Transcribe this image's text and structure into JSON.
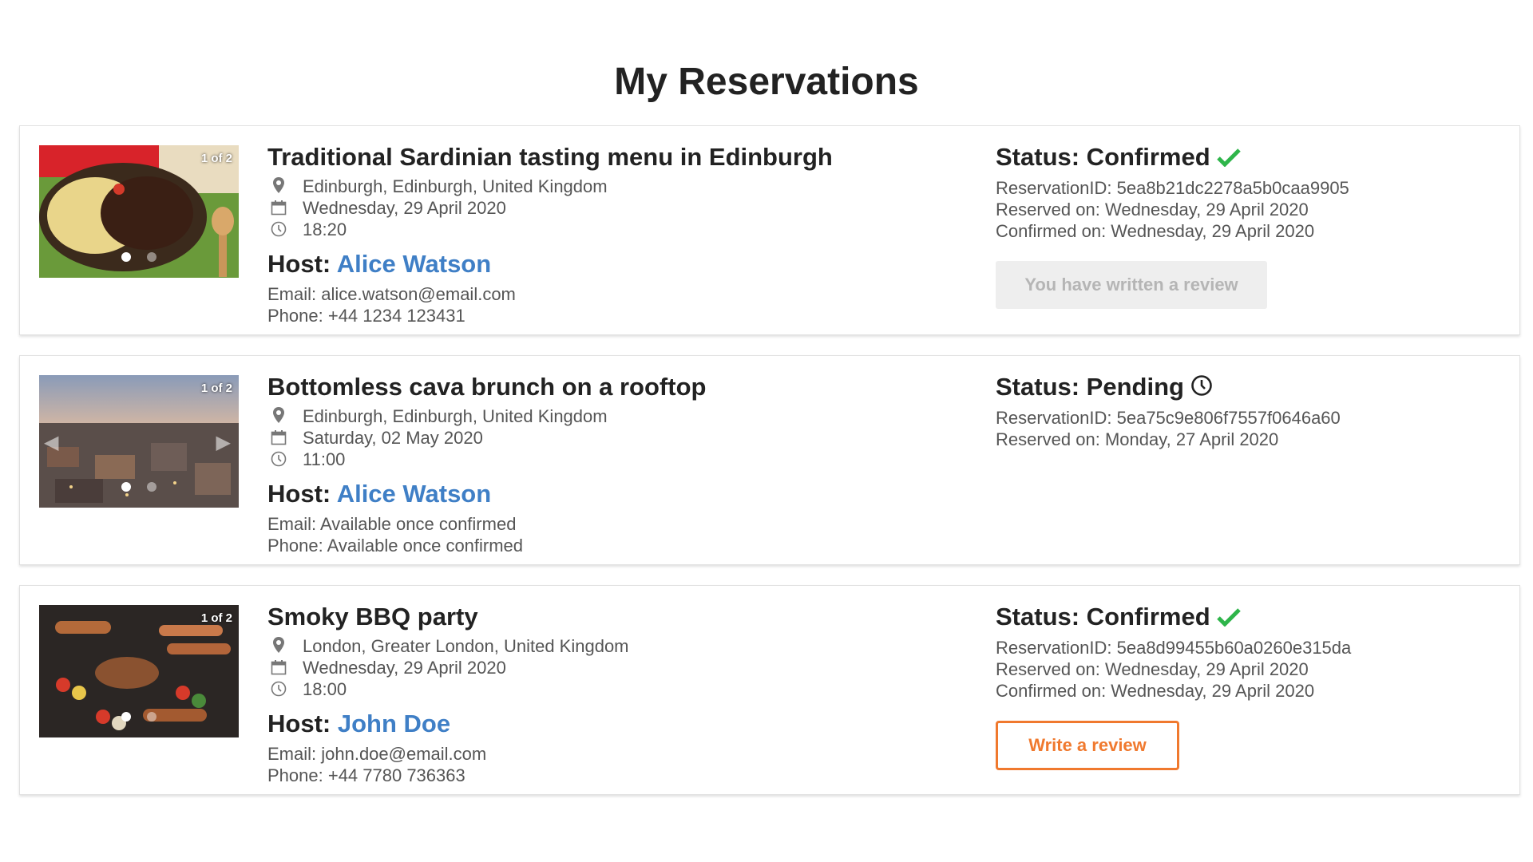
{
  "page": {
    "title": "My Reservations"
  },
  "reservations": [
    {
      "image_counter": "1 of 2",
      "title": "Traditional Sardinian tasting menu in Edinburgh",
      "location": "Edinburgh, Edinburgh, United Kingdom",
      "date": "Wednesday, 29 April 2020",
      "time": "18:20",
      "host_label": "Host:",
      "host_name": "Alice Watson",
      "email": "Email: alice.watson@email.com",
      "phone": "Phone: +44 1234 123431",
      "status": "Status: Confirmed",
      "status_icon": "check-icon",
      "reservation_id": "ReservationID: 5ea8b21dc2278a5b0caa9905",
      "reserved_on": "Reserved on: Wednesday, 29 April 2020",
      "confirmed_on": "Confirmed on: Wednesday, 29 April 2020",
      "button": "You have written a review"
    },
    {
      "image_counter": "1 of 2",
      "title": "Bottomless cava brunch on a rooftop",
      "location": "Edinburgh, Edinburgh, United Kingdom",
      "date": "Saturday, 02 May 2020",
      "time": "11:00",
      "host_label": "Host:",
      "host_name": "Alice Watson",
      "email": "Email: Available once confirmed",
      "phone": "Phone: Available once confirmed",
      "status": "Status: Pending",
      "status_icon": "clock-icon",
      "reservation_id": "ReservationID: 5ea75c9e806f7557f0646a60",
      "reserved_on": "Reserved on: Monday, 27 April 2020"
    },
    {
      "image_counter": "1 of 2",
      "title": "Smoky BBQ party",
      "location": "London, Greater London, United Kingdom",
      "date": "Wednesday, 29 April 2020",
      "time": "18:00",
      "host_label": "Host:",
      "host_name": "John Doe",
      "email": "Email: john.doe@email.com",
      "phone": "Phone: +44 7780 736363",
      "status": "Status: Confirmed",
      "status_icon": "check-icon",
      "reservation_id": "ReservationID: 5ea8d99455b60a0260e315da",
      "reserved_on": "Reserved on: Wednesday, 29 April 2020",
      "confirmed_on": "Confirmed on: Wednesday, 29 April 2020",
      "button": "Write a review"
    }
  ],
  "colors": {
    "link": "#3f7fc6",
    "confirmed_check": "#2eb54a",
    "review_button": "#f0792e",
    "disabled_button_bg": "#eeeeee"
  }
}
